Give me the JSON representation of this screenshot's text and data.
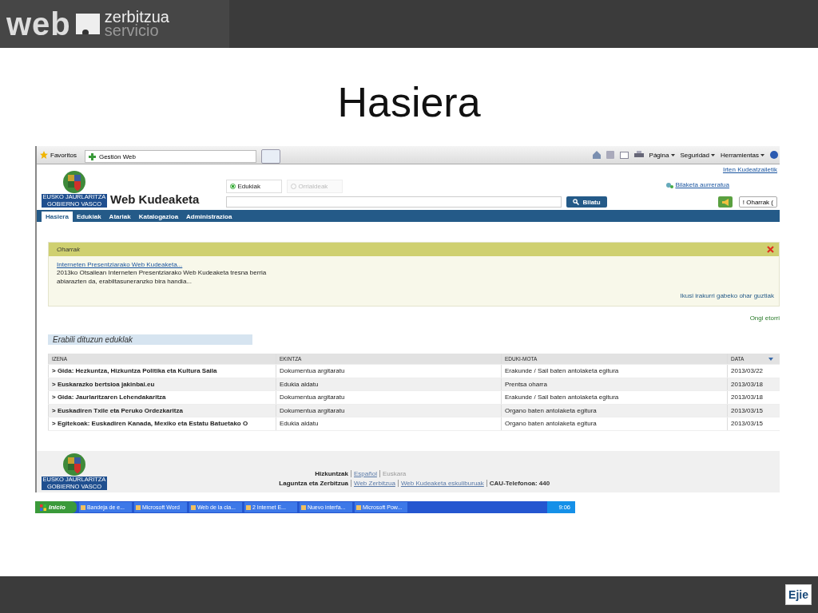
{
  "slide": {
    "brand": {
      "word": "web",
      "line1": "zerbitzua",
      "line2": "servicio"
    },
    "title": "Hasiera",
    "footer_logo": "Ejie"
  },
  "browser": {
    "favorites": "Favoritos",
    "tab": "Gestión Web",
    "commands": [
      "Página",
      "Seguridad",
      "Herramientas"
    ]
  },
  "app": {
    "logo_lines": [
      "EUSKO JAURLARITZA",
      "GOBIERNO VASCO"
    ],
    "title": "Web Kudeaketa",
    "search_scopes": [
      {
        "label": "Edukiak",
        "selected": true
      },
      {
        "label": "Orrialdeak",
        "selected": false
      }
    ],
    "logout": "Irten Kudeatzailetik",
    "advanced_search": "Bilaketa aurreratua",
    "search_button": "Bilatu",
    "notices_button": "! Oharrak (",
    "nav": [
      {
        "label": "Hasiera",
        "selected": true
      },
      {
        "label": "Edukiak",
        "selected": false
      },
      {
        "label": "Atariak",
        "selected": false
      },
      {
        "label": "Katalogazioa",
        "selected": false
      },
      {
        "label": "Administrazioa",
        "selected": false
      }
    ],
    "notices": {
      "title": "Oharrak",
      "link": "Interneten Presentziarako Web Kudeaketa...",
      "text": "2013ko Otsailean Interneten Presentziarako Web Kudeaketa tresna berria abiarazten da, erabiltasuneranzko bira handia...",
      "all_link": "Ikusi irakurri gabeko ohar guztiak"
    },
    "welcome": "Ongi etorri",
    "recent": {
      "title": "Erabili dituzun eduklak",
      "columns": [
        "IZENA",
        "EKINTZA",
        "EDUKI-MOTA",
        "DATA"
      ],
      "rows": [
        [
          "> Gida: Hezkuntza, Hizkuntza Politika eta Kultura Saila",
          "Dokumentua argitaratu",
          "Erakunde / Sail baten antolaketa egitura",
          "2013/03/22"
        ],
        [
          "> Euskarazko bertsioa jakinbai.eu",
          "Edukia aldatu",
          "Prentsa oharra",
          "2013/03/18"
        ],
        [
          "> Gida: Jaurlaritzaren Lehendakaritza",
          "Dokumentua argitaratu",
          "Erakunde / Sail baten antolaketa egitura",
          "2013/03/18"
        ],
        [
          "> Euskadiren Txile eta Peruko Ordezkaritza",
          "Dokumentua argitaratu",
          "Organo baten antolaketa egitura",
          "2013/03/15"
        ],
        [
          "> Egitekoak: Euskadiren Kanada, Mexiko eta Estatu Batuetako O",
          "Edukia aldatu",
          "Organo baten antolaketa egitura",
          "2013/03/15"
        ]
      ]
    },
    "footer": {
      "logo_lines": [
        "EUSKO JAURLARITZA",
        "GOBIERNO VASCO"
      ],
      "languages_label": "Hizkuntzak",
      "languages": [
        {
          "label": "Español",
          "disabled": false
        },
        {
          "label": "Euskara",
          "disabled": true
        }
      ],
      "help_label": "Laguntza eta Zerbitzua",
      "help_links": [
        "Web Zerbitzua",
        "Web Kudeaketa eskuliburuak"
      ],
      "phone": "CAU-Telefonoa: 440"
    }
  },
  "taskbar": {
    "start": "Inicio",
    "items": [
      "Bandeja de e...",
      "Microsoft Word",
      "Web de la cla...",
      "2 Internet E...",
      "Nuevo interfa...",
      "Microsoft Pow..."
    ],
    "clock": "9:06"
  }
}
